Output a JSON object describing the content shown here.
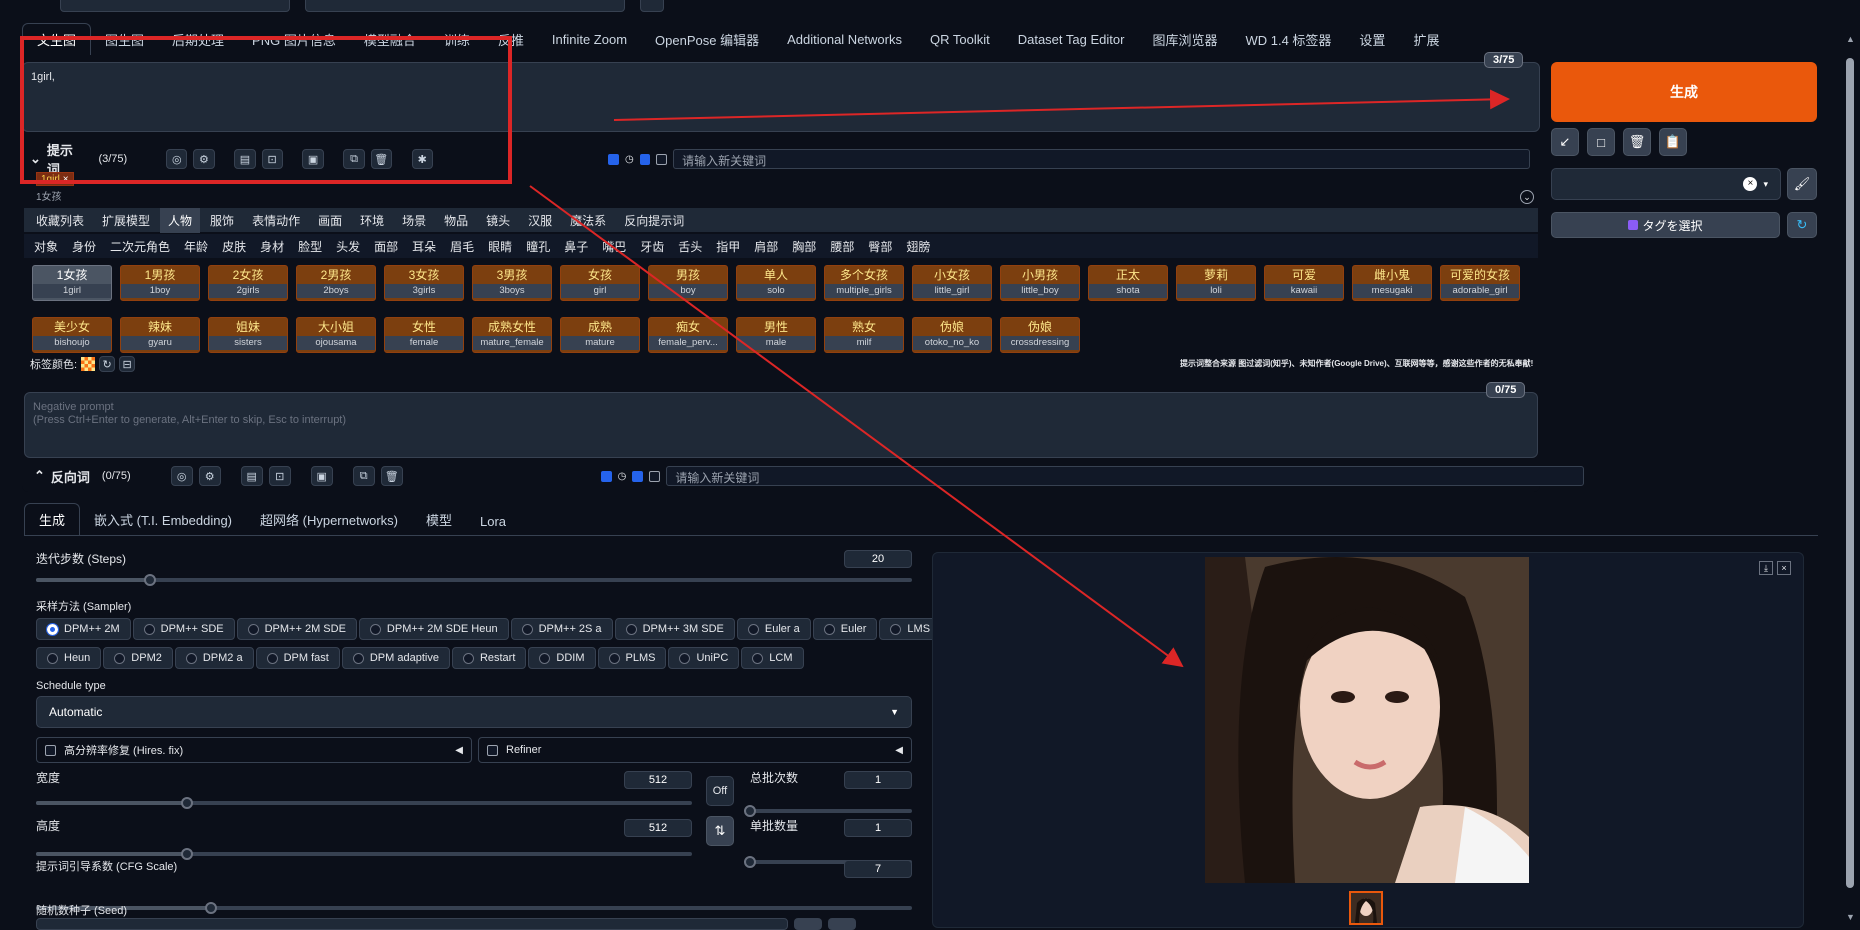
{
  "top_tabs": [
    "文生图",
    "图生图",
    "后期处理",
    "PNG 图片信息",
    "模型融合",
    "训练",
    "反推",
    "Infinite Zoom",
    "OpenPose 编辑器",
    "Additional Networks",
    "QR Toolkit",
    "Dataset Tag Editor",
    "图库浏览器",
    "WD 1.4 标签器",
    "设置",
    "扩展"
  ],
  "prompt": {
    "value": "1girl,",
    "counter": "3/75",
    "label": "提示词",
    "count": "(3/75)",
    "kw_placeholder": "请输入新关键词",
    "chip": "1girl",
    "chip_sub": "1女孩"
  },
  "tag_categories": [
    "收藏列表",
    "扩展模型",
    "人物",
    "服饰",
    "表情动作",
    "画面",
    "环境",
    "场景",
    "物品",
    "镜头",
    "汉服",
    "魔法系",
    "反向提示词"
  ],
  "tag_sub": [
    "对象",
    "身份",
    "二次元角色",
    "年龄",
    "皮肤",
    "身材",
    "脸型",
    "头发",
    "面部",
    "耳朵",
    "眉毛",
    "眼睛",
    "瞳孔",
    "鼻子",
    "嘴巴",
    "牙齿",
    "舌头",
    "指甲",
    "肩部",
    "胸部",
    "腰部",
    "臀部",
    "翅膀"
  ],
  "tags_row1": [
    [
      "1女孩",
      "1girl"
    ],
    [
      "1男孩",
      "1boy"
    ],
    [
      "2女孩",
      "2girls"
    ],
    [
      "2男孩",
      "2boys"
    ],
    [
      "3女孩",
      "3girls"
    ],
    [
      "3男孩",
      "3boys"
    ],
    [
      "女孩",
      "girl"
    ],
    [
      "男孩",
      "boy"
    ],
    [
      "单人",
      "solo"
    ],
    [
      "多个女孩",
      "multiple_girls"
    ],
    [
      "小女孩",
      "little_girl"
    ],
    [
      "小男孩",
      "little_boy"
    ],
    [
      "正太",
      "shota"
    ],
    [
      "萝莉",
      "loli"
    ],
    [
      "可爱",
      "kawaii"
    ],
    [
      "雌小鬼",
      "mesugaki"
    ],
    [
      "可爱的女孩",
      "adorable_girl"
    ]
  ],
  "tags_row2": [
    [
      "美少女",
      "bishoujo"
    ],
    [
      "辣妹",
      "gyaru"
    ],
    [
      "姐妹",
      "sisters"
    ],
    [
      "大小姐",
      "ojousama"
    ],
    [
      "女性",
      "female"
    ],
    [
      "成熟女性",
      "mature_female"
    ],
    [
      "成熟",
      "mature"
    ],
    [
      "痴女",
      "female_perv..."
    ],
    [
      "男性",
      "male"
    ],
    [
      "熟女",
      "milf"
    ],
    [
      "伪娘",
      "otoko_no_ko"
    ],
    [
      "伪娘",
      "crossdressing"
    ]
  ],
  "tag_color_label": "标签颜色:",
  "credits": "提示词整合来源 图过滤词(知乎)、未知作者(Google Drive)、互联网等等，感谢这些作者的无私奉献!",
  "negative": {
    "placeholder": "Negative prompt\n(Press Ctrl+Enter to generate, Alt+Enter to skip, Esc to interrupt)",
    "counter": "0/75",
    "label": "反向词",
    "count": "(0/75)",
    "kw_placeholder": "请输入新关键词"
  },
  "generate_label": "生成",
  "tag_select_label": "タグを選択",
  "gen_tabs": [
    "生成",
    "嵌入式 (T.I. Embedding)",
    "超网络 (Hypernetworks)",
    "模型",
    "Lora"
  ],
  "steps": {
    "label": "迭代步数 (Steps)",
    "value": "20",
    "fraction": 0.13
  },
  "sampler": {
    "label": "采样方法 (Sampler)",
    "options_row1": [
      "DPM++ 2M",
      "DPM++ SDE",
      "DPM++ 2M SDE",
      "DPM++ 2M SDE Heun",
      "DPM++ 2S a",
      "DPM++ 3M SDE",
      "Euler a",
      "Euler",
      "LMS"
    ],
    "options_row2": [
      "Heun",
      "DPM2",
      "DPM2 a",
      "DPM fast",
      "DPM adaptive",
      "Restart",
      "DDIM",
      "PLMS",
      "UniPC",
      "LCM"
    ],
    "selected": "DPM++ 2M"
  },
  "schedule": {
    "label": "Schedule type",
    "value": "Automatic"
  },
  "hires": {
    "label": "高分辨率修复 (Hires. fix)"
  },
  "refiner": {
    "label": "Refiner"
  },
  "width": {
    "label": "宽度",
    "value": "512",
    "fraction": 0.23
  },
  "height": {
    "label": "高度",
    "value": "512",
    "fraction": 0.23
  },
  "batch_count": {
    "label": "总批次数",
    "value": "1",
    "fraction": 0.0
  },
  "batch_size": {
    "label": "单批数量",
    "value": "1",
    "fraction": 0.0
  },
  "swap_label": "Off",
  "cfg": {
    "label": "提示词引导系数 (CFG Scale)",
    "value": "7",
    "fraction": 0.2
  },
  "seed": {
    "label": "随机数种子 (Seed)"
  },
  "colors": {
    "accent": "#ea580c",
    "tag_bg": "#7c3f0f",
    "annotation": "#dc2626"
  }
}
